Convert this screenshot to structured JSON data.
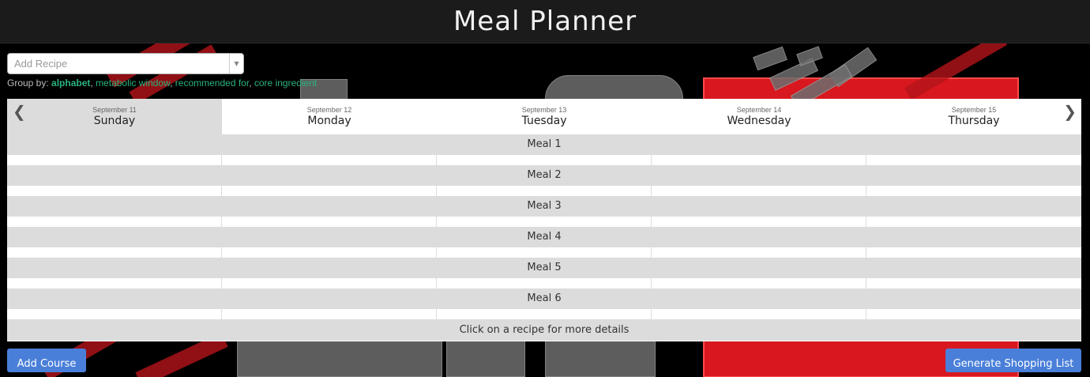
{
  "app": {
    "title": "Meal Planner"
  },
  "recipe_select": {
    "placeholder": "Add Recipe",
    "arrow_icon": "triangle-down-icon"
  },
  "group_by": {
    "label": "Group by:",
    "options": [
      {
        "label": "alphabet",
        "active": true
      },
      {
        "label": "metabolic window",
        "active": false
      },
      {
        "label": "recommended for",
        "active": false
      },
      {
        "label": "core ingredient",
        "active": false
      }
    ],
    "separator": ", "
  },
  "planner": {
    "prev_icon": "chevron-left-icon",
    "next_icon": "chevron-right-icon",
    "days": [
      {
        "date": "September 11",
        "name": "Sunday",
        "active": true
      },
      {
        "date": "September 12",
        "name": "Monday",
        "active": false
      },
      {
        "date": "September 13",
        "name": "Tuesday",
        "active": false
      },
      {
        "date": "September 14",
        "name": "Wednesday",
        "active": false
      },
      {
        "date": "September 15",
        "name": "Thursday",
        "active": false
      }
    ],
    "meals": [
      "Meal 1",
      "Meal 2",
      "Meal 3",
      "Meal 4",
      "Meal 5",
      "Meal 6"
    ],
    "footer_note": "Click on a recipe for more details"
  },
  "buttons": {
    "add_course": "Add Course",
    "generate_shopping_list": "Generate Shopping List"
  },
  "colors": {
    "accent_button": "#4a7fd9",
    "link_green": "#2bb37e",
    "topbar": "#1b1b1b",
    "row_grey": "#dcdcdc"
  }
}
